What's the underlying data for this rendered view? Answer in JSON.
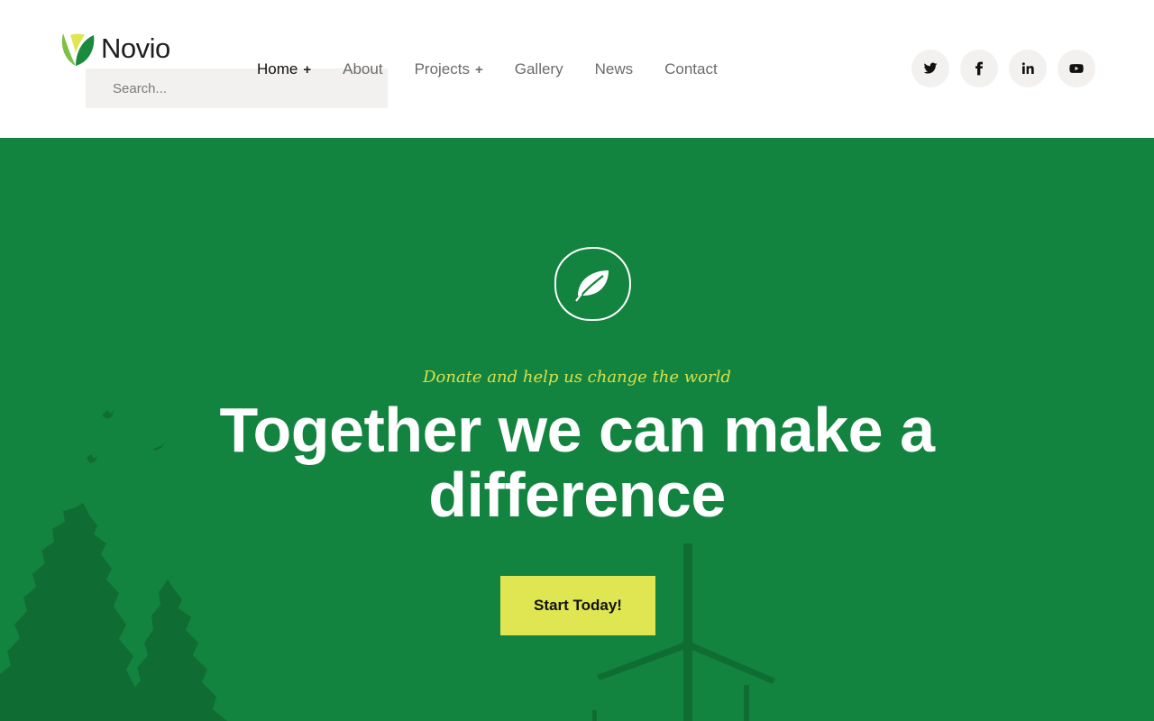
{
  "brand": {
    "name": "Novio"
  },
  "search": {
    "placeholder": "Search..."
  },
  "nav": {
    "home": "Home",
    "about": "About",
    "projects": "Projects",
    "gallery": "Gallery",
    "news": "News",
    "contact": "Contact"
  },
  "socials": [
    "twitter-icon",
    "facebook-icon",
    "linkedin-icon",
    "youtube-icon"
  ],
  "hero": {
    "tagline": "Donate and help us change the world",
    "headline": "Together we can make a difference",
    "cta": "Start Today!"
  },
  "colors": {
    "hero_bg": "#12843f",
    "accent_yellow": "#dfe651",
    "tagline": "#d8e04a",
    "silhouette": "#0f6d33"
  }
}
